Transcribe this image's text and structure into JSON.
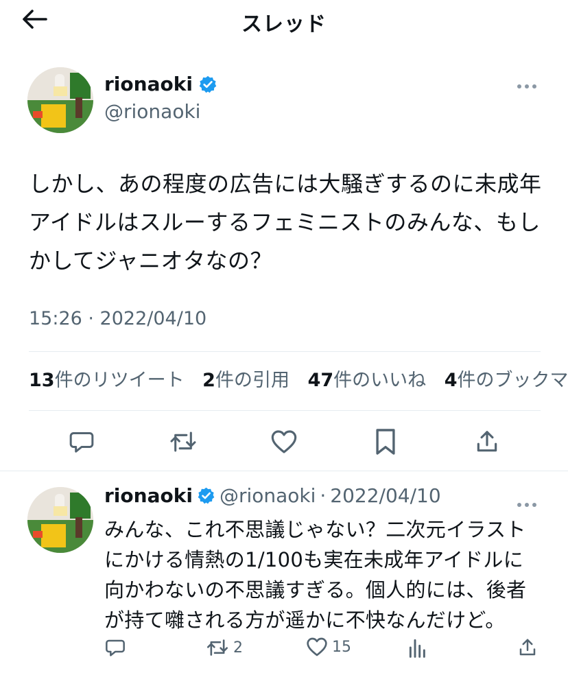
{
  "header": {
    "title": "スレッド",
    "back_icon": "arrow-left-icon"
  },
  "tweet": {
    "display_name": "rionaoki",
    "handle": "@rionaoki",
    "verified": true,
    "text": "しかし、あの程度の広告には大騒ぎするのに未成年アイドルはスルーするフェミニストのみんな、もしかしてジャニオタなの？",
    "timestamp": "15:26 · 2022/04/10",
    "stats": [
      {
        "count": "13",
        "label": "件のリツイート"
      },
      {
        "count": "2",
        "label": "件の引用"
      },
      {
        "count": "47",
        "label": "件のいいね"
      },
      {
        "count": "4",
        "label": "件のブックマーク"
      }
    ]
  },
  "reply": {
    "display_name": "rionaoki",
    "handle": "@rionaoki",
    "date_sep": "·",
    "date": "2022/04/10",
    "text": "みんな、これ不思議じゃない？二次元イラストにかける情熱の1/100も実在未成年アイドルに向かわないの不思議すぎる。個人的には、後者が持て囃される方が遥かに不快なんだけど。",
    "retweets": "2",
    "likes": "15"
  },
  "colors": {
    "verified": "#1d9bf0",
    "secondary_text": "#536471",
    "divider": "#e6ecf0"
  }
}
